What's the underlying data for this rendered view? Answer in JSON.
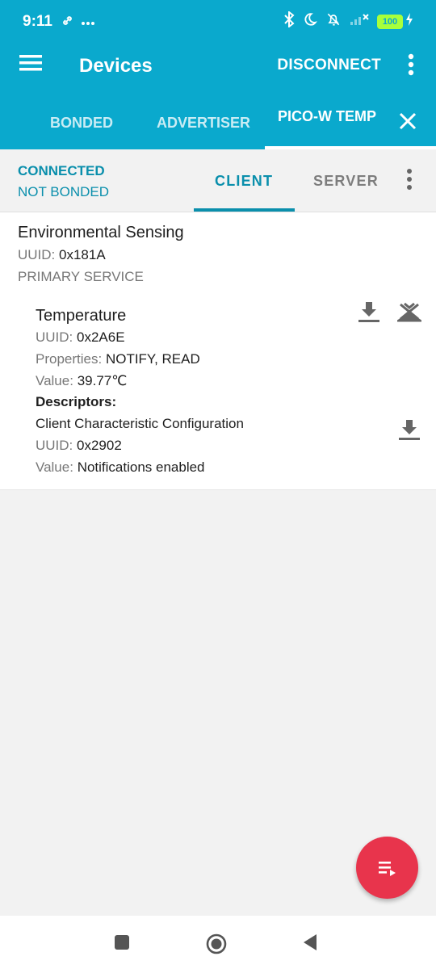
{
  "status_bar": {
    "time": "9:11",
    "link_icon": "link-icon",
    "more_icon": "ellipsis-icon",
    "bluetooth_icon": "bluetooth-icon",
    "dnd_icon": "moon-icon",
    "silent_icon": "bell-off-icon",
    "signal_icon": "signal-icon",
    "battery_level": "100",
    "charging_icon": "bolt-icon"
  },
  "toolbar": {
    "title": "Devices",
    "disconnect_label": "DISCONNECT",
    "menu_icon": "hamburger-icon",
    "overflow_icon": "more-vert-icon"
  },
  "tabs": [
    {
      "label": "BONDED"
    },
    {
      "label": "ADVERTISER"
    },
    {
      "label": "PICO-W TEMP"
    }
  ],
  "connection": {
    "status": "CONNECTED",
    "bond_status": "NOT BONDED",
    "client_tab": "CLIENT",
    "server_tab": "SERVER"
  },
  "service": {
    "name": "Environmental Sensing",
    "uuid_label": "UUID:",
    "uuid_value": "0x181A",
    "type": "PRIMARY SERVICE",
    "characteristic": {
      "name": "Temperature",
      "uuid_label": "UUID:",
      "uuid_value": "0x2A6E",
      "properties_label": "Properties:",
      "properties_value": "NOTIFY, READ",
      "value_label": "Value:",
      "value_value": "39.77℃",
      "descriptors_label": "Descriptors:",
      "descriptor": {
        "name": "Client Characteristic Configuration",
        "uuid_label": "UUID:",
        "uuid_value": "0x2902",
        "value_label": "Value:",
        "value_value": "Notifications enabled"
      }
    }
  },
  "actions": {
    "read_icon": "download-icon",
    "notify_icon": "notifications-off-icon",
    "descriptor_read_icon": "download-icon",
    "fab_icon": "playlist-play-icon"
  },
  "colors": {
    "primary": "#0aa9cd",
    "primary_dark_text": "#0a8fac",
    "fab": "#e8344c",
    "battery": "#a8ff3c"
  },
  "nav": {
    "recents_icon": "square-icon",
    "home_icon": "circle-icon",
    "back_icon": "triangle-back-icon"
  }
}
